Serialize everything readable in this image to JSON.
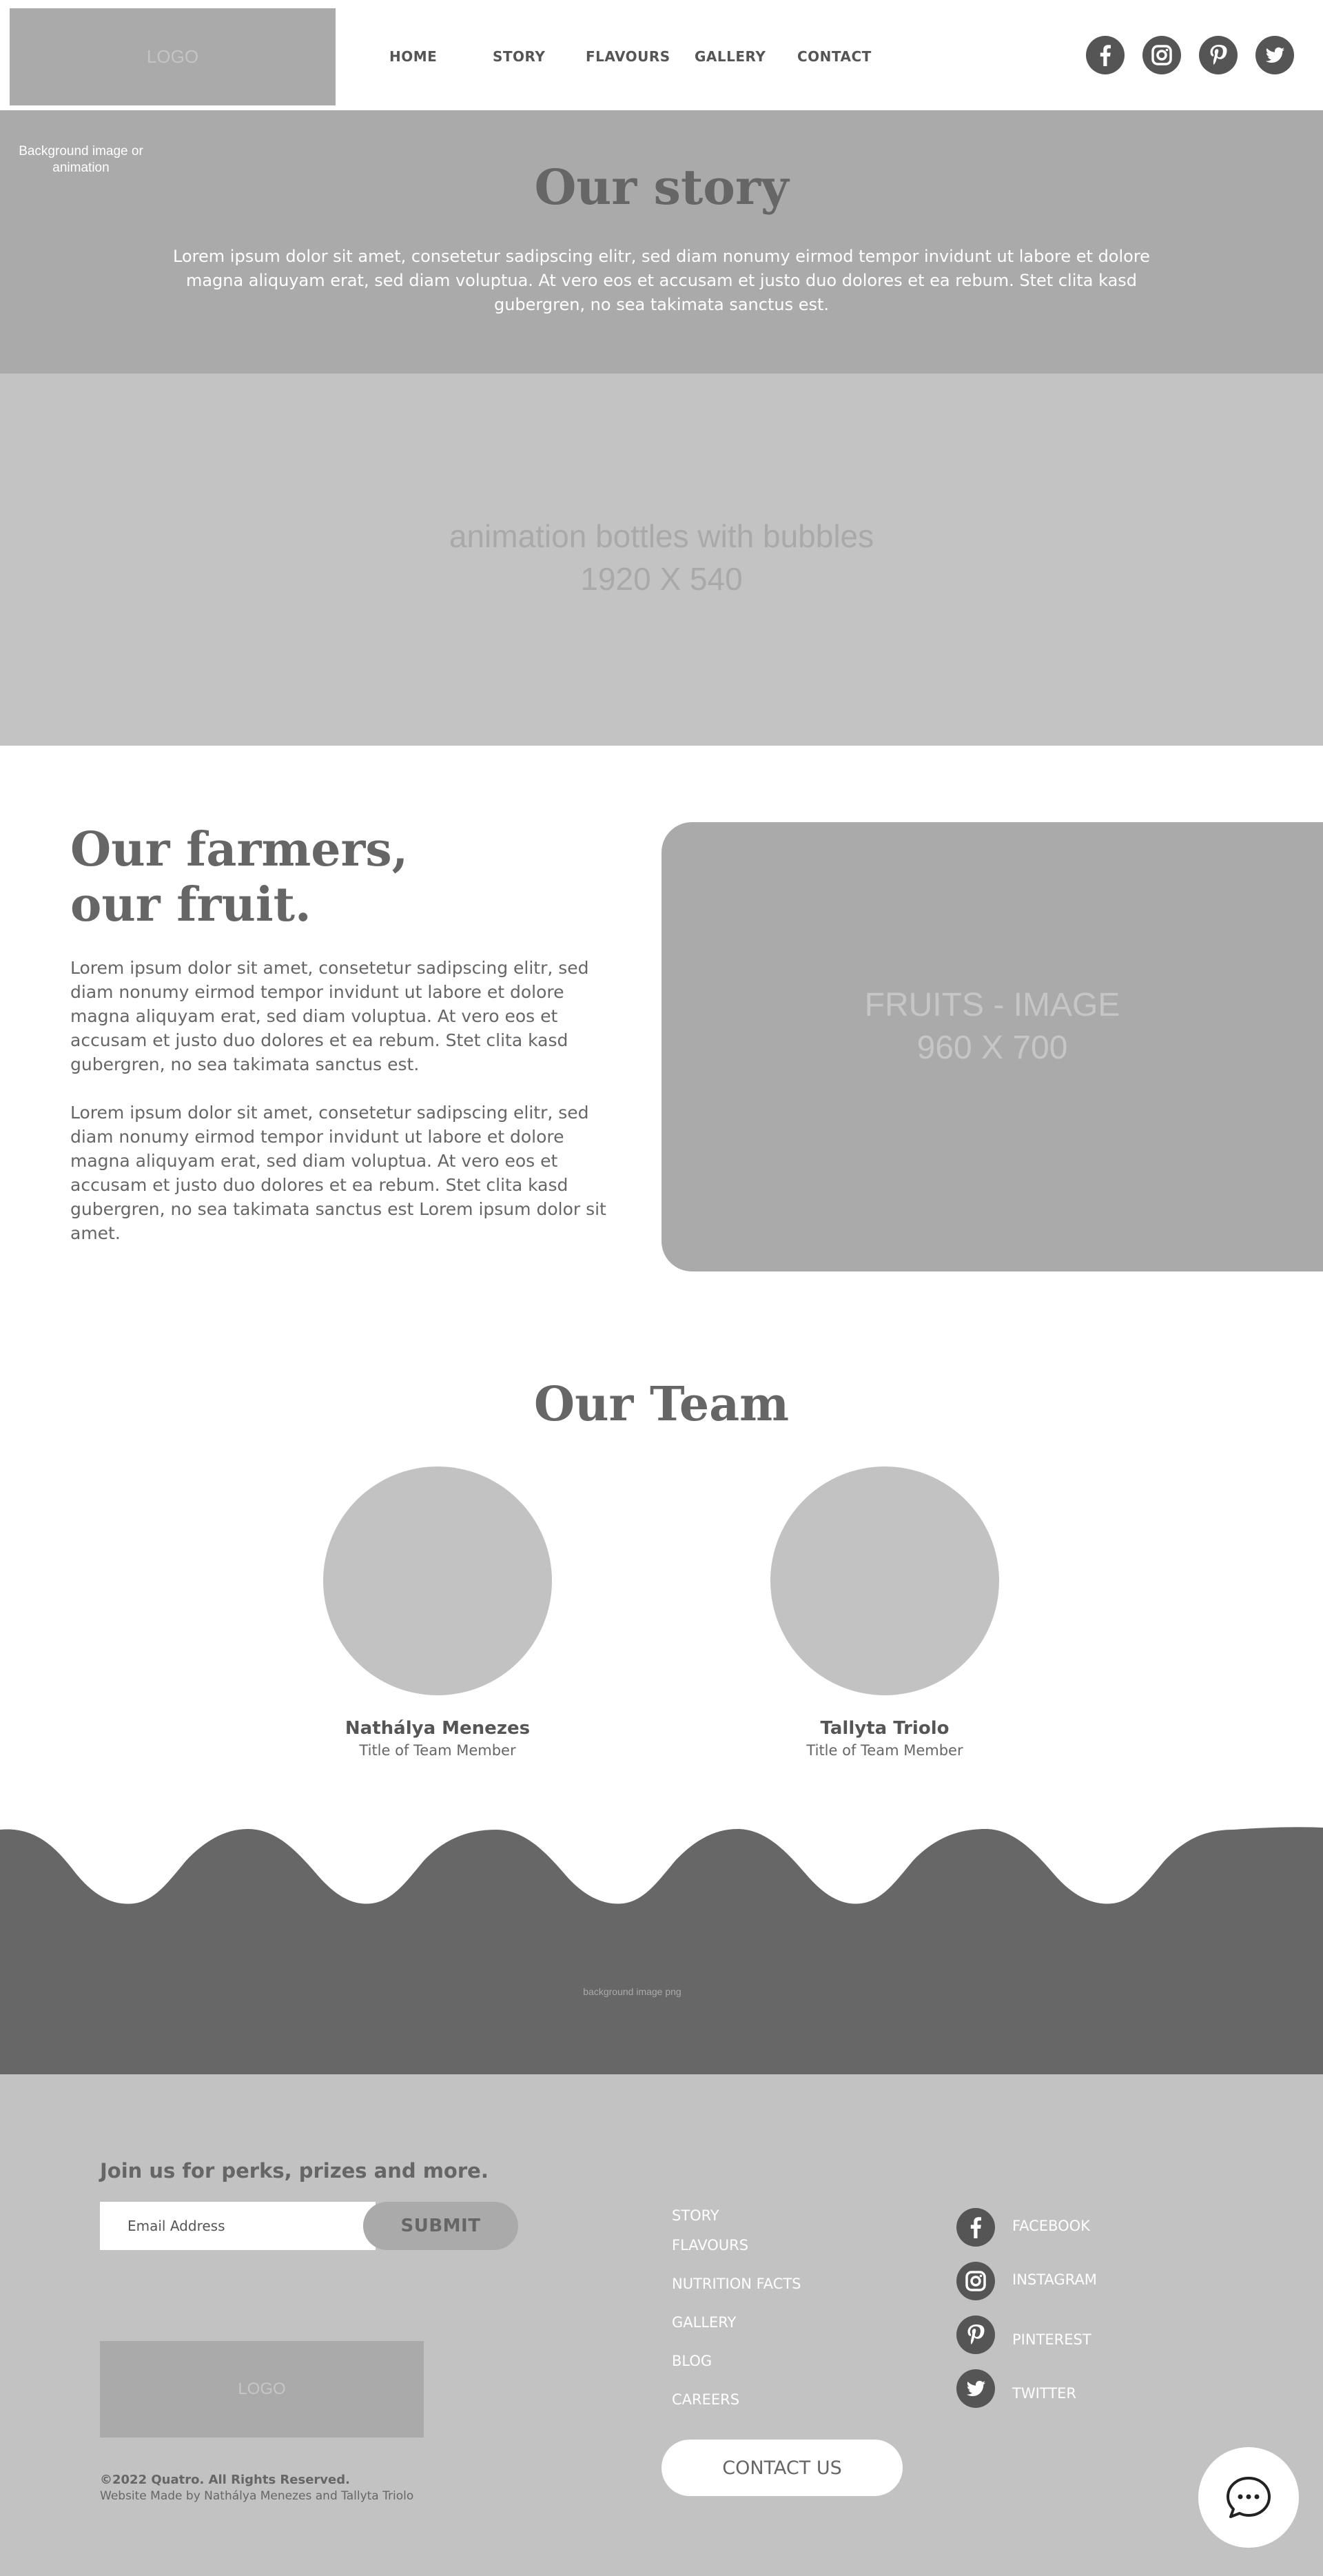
{
  "header": {
    "logo": "LOGO",
    "nav": [
      "HOME",
      "STORY",
      "FLAVOURS",
      "GALLERY",
      "CONTACT"
    ],
    "social_icons": [
      "facebook-icon",
      "instagram-icon",
      "pinterest-icon",
      "twitter-icon"
    ]
  },
  "story": {
    "bg_note": "Background image or animation",
    "title": "Our story",
    "text": "Lorem ipsum dolor sit amet, consetetur sadipscing elitr, sed diam nonumy eirmod tempor invidunt ut labore et dolore magna aliquyam erat, sed diam voluptua. At vero eos et accusam et justo duo dolores et ea rebum. Stet clita kasd gubergren, no sea takimata sanctus est."
  },
  "animation": {
    "label_line1": "animation bottles with bubbles",
    "label_line2": "1920 X 540"
  },
  "farmers": {
    "title_line1": "Our farmers,",
    "title_line2": "our fruit.",
    "para1": "Lorem ipsum dolor sit amet, consetetur sadipscing elitr, sed diam nonumy eirmod tempor invidunt ut labore et dolore magna aliquyam erat, sed diam voluptua. At vero eos et accusam et justo duo dolores et ea rebum. Stet clita kasd gubergren, no sea takimata sanctus est.",
    "para2": "Lorem ipsum dolor sit amet, consetetur sadipscing elitr, sed diam nonumy eirmod tempor invidunt ut labore et dolore magna aliquyam erat, sed diam voluptua. At vero eos et accusam et justo duo dolores et ea rebum. Stet clita kasd gubergren, no sea takimata sanctus est Lorem ipsum dolor sit amet.",
    "image_line1": "FRUITS - IMAGE",
    "image_line2": "960 X 700"
  },
  "team": {
    "title": "Our Team",
    "members": [
      {
        "name": "Nathálya Menezes",
        "title": "Title of Team Member"
      },
      {
        "name": "Tallyta Triolo",
        "title": "Title of Team Member"
      }
    ]
  },
  "waves": {
    "label": "background image png",
    "color": "#676767"
  },
  "footer": {
    "newsletter_heading": "Join us for perks, prizes and more.",
    "email_placeholder": "Email Address",
    "submit_label": "SUBMIT",
    "logo": "LOGO",
    "copyright": "©2022 Quatro. All Rights Reserved.",
    "made_by": "Website Made by Nathálya Menezes and Tallyta Triolo",
    "links": [
      "STORY",
      "FLAVOURS",
      "NUTRITION FACTS",
      "GALLERY",
      "BLOG",
      "CAREERS"
    ],
    "contact_label": "CONTACT US",
    "social": [
      {
        "icon": "facebook-icon",
        "label": "FACEBOOK"
      },
      {
        "icon": "instagram-icon",
        "label": "INSTAGRAM"
      },
      {
        "icon": "pinterest-icon",
        "label": "PINTEREST"
      },
      {
        "icon": "twitter-icon",
        "label": "TWITTER"
      }
    ],
    "chat_icon": "chat-icon"
  }
}
